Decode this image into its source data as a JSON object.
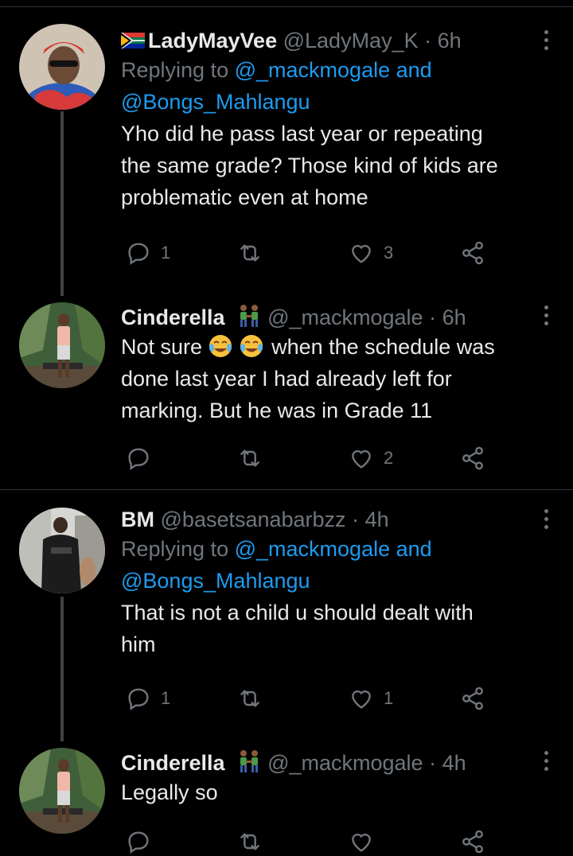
{
  "tweets": [
    {
      "name": "LadyMayVee",
      "handle": "@LadyMay_K",
      "dot": "·",
      "time": "6h",
      "replying_prefix": "Replying to",
      "replying_mention1": "@_mackmogale",
      "replying_and": "and",
      "replying_mention2": "@Bongs_Mahlangu",
      "text_lines": [
        "Yho did he pass last year or repeating",
        "the same grade? Those kind of kids are",
        "problematic even at home"
      ],
      "replies": "1",
      "retweets": "",
      "likes": "3"
    },
    {
      "name": "Cinderella",
      "handle": "@_mackmogale",
      "dot": "·",
      "time": "6h",
      "text_line1_a": "Not sure",
      "text_line1_b": "when the schedule was",
      "text_lines": [
        "done last year I had already left for",
        "marking. But he was in Grade 11"
      ],
      "replies": "",
      "retweets": "",
      "likes": "2"
    },
    {
      "name": "BM",
      "handle": "@basetsanabarbzz",
      "dot": "·",
      "time": "4h",
      "replying_prefix": "Replying to",
      "replying_mention1": "@_mackmogale",
      "replying_and": "and",
      "replying_mention2": "@Bongs_Mahlangu",
      "text_lines": [
        "That is not a child u should dealt with",
        "him"
      ],
      "replies": "1",
      "retweets": "",
      "likes": "1"
    },
    {
      "name": "Cinderella",
      "handle": "@_mackmogale",
      "dot": "·",
      "time": "4h",
      "text_lines": [
        "Legally so"
      ],
      "replies": "",
      "retweets": "",
      "likes": ""
    }
  ],
  "colors": {
    "background": "#000000",
    "text": "#e7e9ea",
    "muted": "#71767b",
    "link": "#1d9bf0",
    "divider": "#2f3336"
  }
}
